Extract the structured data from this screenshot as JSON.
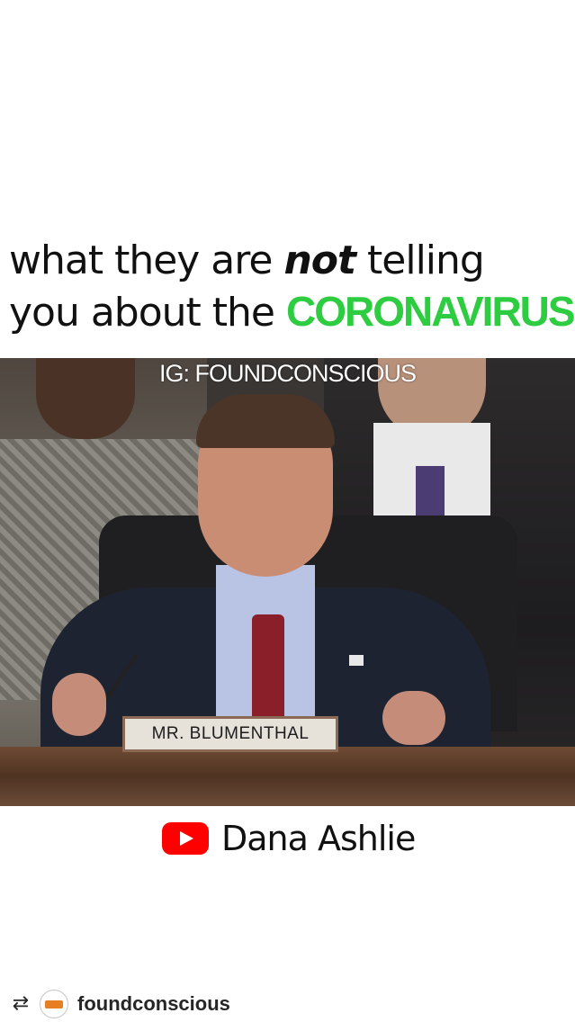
{
  "headline": {
    "line1_pre": "what they are ",
    "line1_emph": "not",
    "line1_post": " telling",
    "line2_pre": "you about the ",
    "line2_highlight": "CORONAVIRUS",
    "highlight_color": "#2ecc40"
  },
  "video": {
    "watermark": "IG: FOUNDCONSCIOUS",
    "nameplate": "MR. BLUMENTHAL"
  },
  "attribution": {
    "icon": "youtube-icon",
    "name": "Dana Ashlie"
  },
  "footer": {
    "repost_icon": "repost-icon",
    "handle": "foundconscious"
  }
}
